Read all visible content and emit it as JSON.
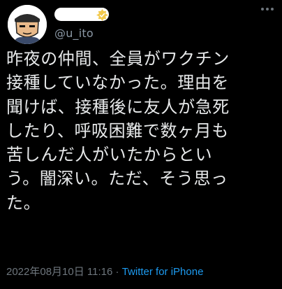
{
  "header": {
    "handle": "@u_ito"
  },
  "tweet": {
    "lines": [
      "昨夜の仲間、全員がワクチン",
      "接種していなかった。理由を",
      "聞けば、接種後に友人が急死",
      "したり、呼吸困難で数ヶ月も",
      "苦しんだ人がいたからとい",
      "う。闇深い。ただ、そう思っ",
      "た。"
    ]
  },
  "meta": {
    "timestamp": "2022年08月10日 11:16",
    "separator": " · ",
    "source": "Twitter for iPhone"
  },
  "icons": {
    "avatar": "cartoon-avatar",
    "verified": "verified-badge-icon",
    "more": "more-options-icon"
  },
  "colors": {
    "background": "#000000",
    "text": "#e7e9ea",
    "secondary": "#8b98a5",
    "link": "#1d9bf0"
  }
}
